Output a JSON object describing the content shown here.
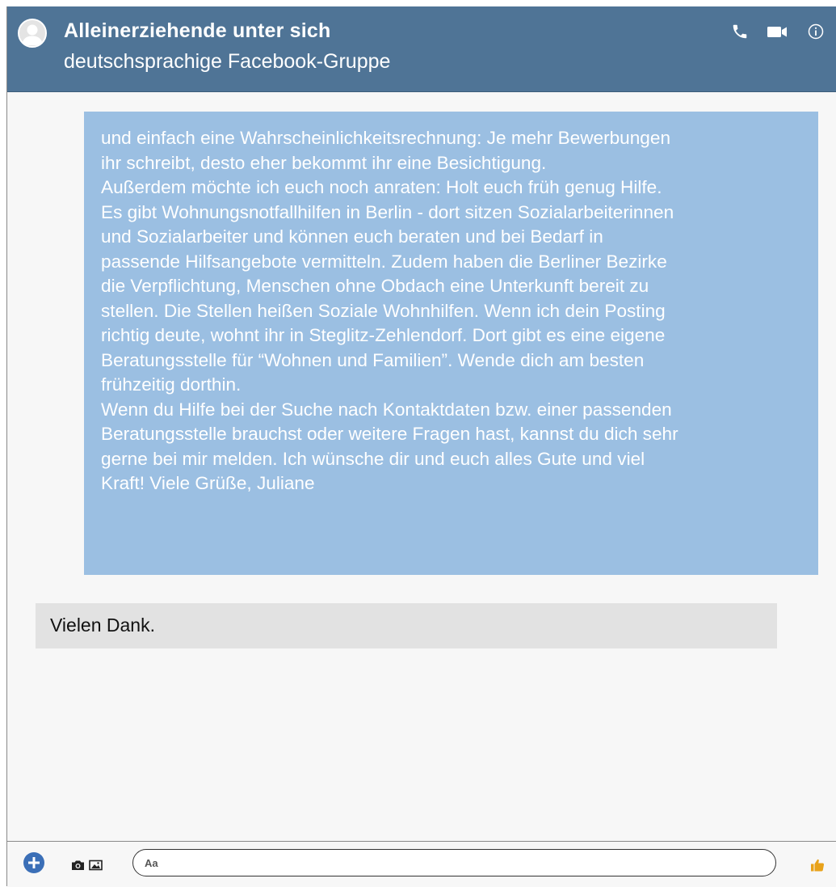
{
  "header": {
    "title": "Alleinerziehende unter sich",
    "subtitle": "deutschsprachige Facebook-Gruppe",
    "icons": [
      "avatar-icon",
      "phone-icon",
      "video-icon",
      "info-icon"
    ]
  },
  "messages": {
    "incoming": "und einfach eine Wahrscheinlichkeitsrechnung: Je mehr Bewerbungen\nihr schreibt, desto eher bekommt ihr eine Besichtigung.\nAußerdem möchte ich euch noch anraten: Holt euch früh genug Hilfe.\nEs gibt Wohnungsnotfallhilfen in Berlin - dort sitzen Sozialarbeiterinnen\nund Sozialarbeiter und können euch beraten und bei Bedarf in\npassende Hilfsangebote vermitteln. Zudem haben die Berliner Bezirke\ndie Verpflichtung, Menschen ohne Obdach eine Unterkunft bereit zu\nstellen. Die Stellen heißen Soziale Wohnhilfen. Wenn ich dein Posting\nrichtig deute, wohnt ihr in Steglitz-Zehlendorf. Dort gibt es eine eigene\nBeratungsstelle für “Wohnen und Familien”. Wende dich am besten\nfrühzeitig dorthin.\nWenn du Hilfe bei der Suche nach Kontaktdaten bzw. einer passenden\nBeratungsstelle brauchst oder weitere Fragen hast, kannst du dich sehr\ngerne bei mir melden. Ich wünsche dir und euch alles Gute und viel\nKraft! Viele Grüße, Juliane",
    "outgoing": "Vielen Dank."
  },
  "composer": {
    "placeholder": "Aa",
    "icons": [
      "plus-icon",
      "camera-icon",
      "gallery-icon",
      "like-icon"
    ]
  },
  "colors": {
    "header_bg": "#4f7496",
    "incoming_bg": "#9bbfe2",
    "outgoing_bg": "#e2e2e2",
    "accent": "#3b6fb7"
  }
}
